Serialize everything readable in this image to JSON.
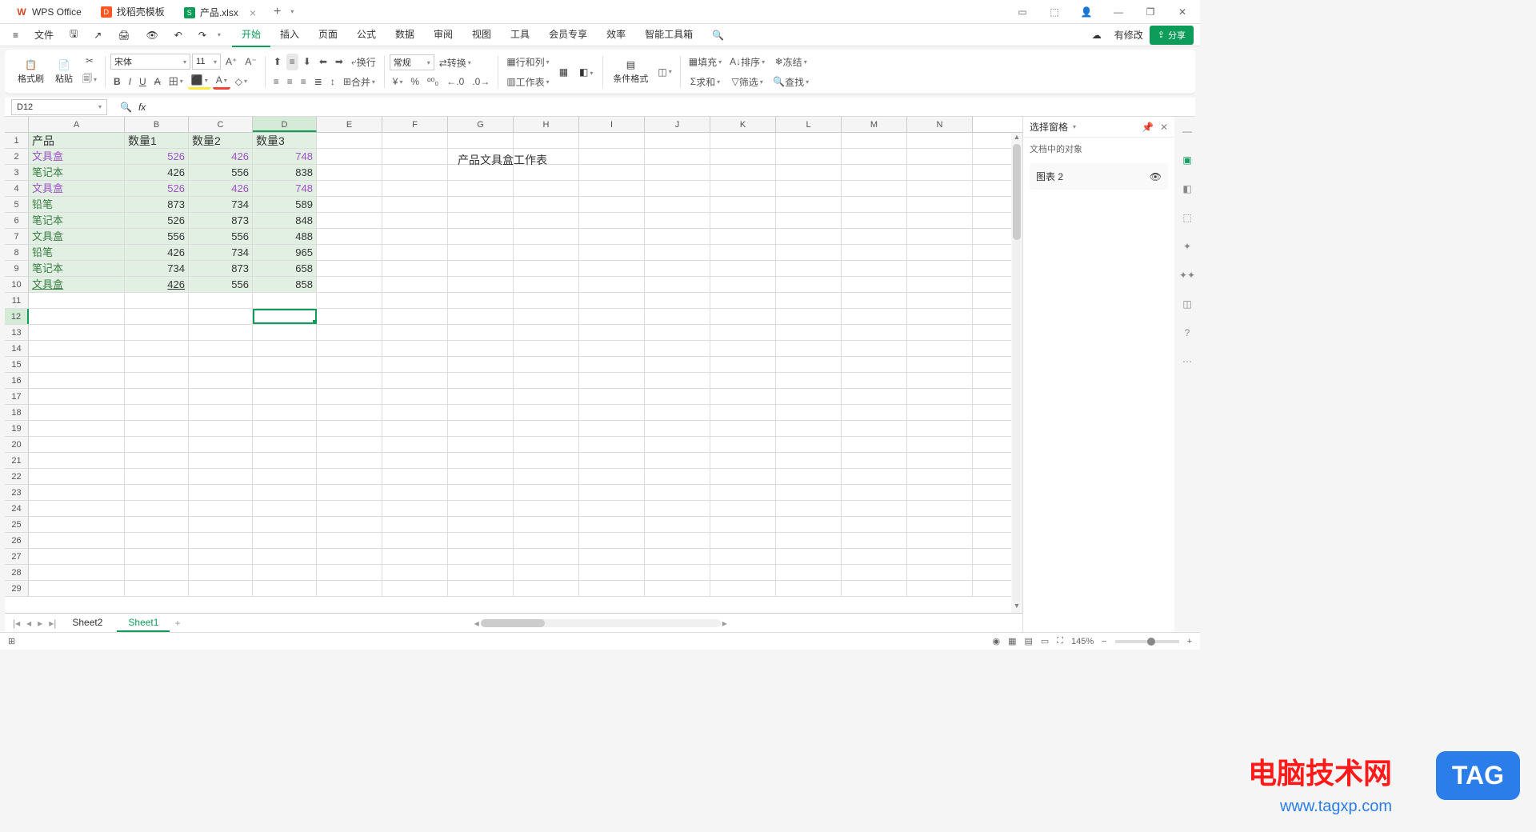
{
  "titlebar": {
    "tabs": [
      {
        "icon": "wps",
        "label": "WPS Office"
      },
      {
        "icon": "template",
        "label": "找稻壳模板"
      },
      {
        "icon": "sheet",
        "label": "产品.xlsx",
        "close": "×"
      }
    ],
    "add": "+"
  },
  "menubar": {
    "file": "文件",
    "tabs": [
      "开始",
      "插入",
      "页面",
      "公式",
      "数据",
      "审阅",
      "视图",
      "工具",
      "会员专享",
      "效率",
      "智能工具箱"
    ],
    "active_tab": 0,
    "modified": "有修改",
    "share": "分享"
  },
  "toolbar": {
    "format_brush": "格式刷",
    "paste": "粘贴",
    "font_name": "宋体",
    "font_size": "11",
    "wrap": "换行",
    "merge": "合并",
    "format_style": "常规",
    "convert": "转换",
    "rowcol": "行和列",
    "worksheet": "工作表",
    "condition": "条件格式",
    "fill": "填充",
    "sort": "排序",
    "freeze": "冻结",
    "sum": "求和",
    "filter": "筛选",
    "find": "查找"
  },
  "namebox": "D12",
  "columns": [
    "A",
    "B",
    "C",
    "D",
    "E",
    "F",
    "G",
    "H",
    "I",
    "J",
    "K",
    "L",
    "M",
    "N"
  ],
  "selected_col": "D",
  "selected_row": 12,
  "sheet_rows": [
    {
      "n": 1,
      "a": "产品",
      "b": "数量1",
      "c": "数量2",
      "d": "数量3",
      "hdr": true
    },
    {
      "n": 2,
      "a": "文具盒",
      "b": "526",
      "c": "426",
      "d": "748",
      "hl": true,
      "purple": true
    },
    {
      "n": 3,
      "a": "笔记本",
      "b": "426",
      "c": "556",
      "d": "838",
      "hl": true
    },
    {
      "n": 4,
      "a": "文具盒",
      "b": "526",
      "c": "426",
      "d": "748",
      "hl": true,
      "purple": true
    },
    {
      "n": 5,
      "a": "铅笔",
      "b": "873",
      "c": "734",
      "d": "589",
      "hl": true
    },
    {
      "n": 6,
      "a": "笔记本",
      "b": "526",
      "c": "873",
      "d": "848",
      "hl": true
    },
    {
      "n": 7,
      "a": "文具盒",
      "b": "556",
      "c": "556",
      "d": "488",
      "hl": true
    },
    {
      "n": 8,
      "a": "铅笔",
      "b": "426",
      "c": "734",
      "d": "965",
      "hl": true
    },
    {
      "n": 9,
      "a": "笔记本",
      "b": "734",
      "c": "873",
      "d": "658",
      "hl": true
    },
    {
      "n": 10,
      "a": "文具盒",
      "b": "426",
      "c": "556",
      "d": "858",
      "hl": true,
      "underline": true,
      "b_underline": true
    }
  ],
  "empty_rows_to": 29,
  "floating_label": "产品文具盒工作表",
  "sheet_tabs": {
    "tabs": [
      "Sheet2",
      "Sheet1"
    ],
    "active": 1,
    "add": "+"
  },
  "side": {
    "title": "选择窗格",
    "sub": "文档中的对象",
    "item": "图表 2"
  },
  "status": {
    "zoom": "145%"
  },
  "watermark": {
    "line1": "电脑技术网",
    "tag": "TAG",
    "url": "www.tagxp.com"
  }
}
